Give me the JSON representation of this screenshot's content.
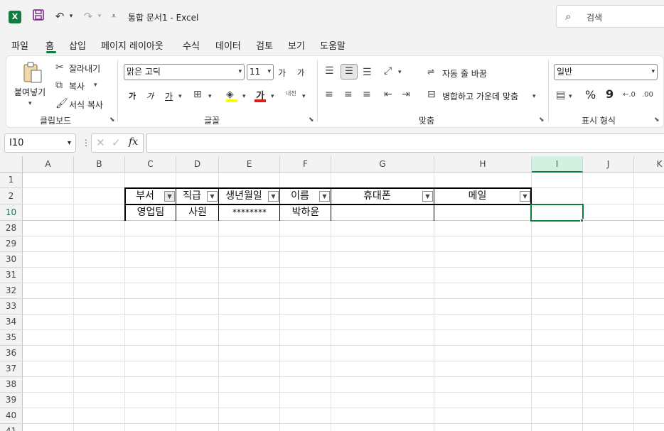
{
  "titlebar": {
    "app_icon": "excel-logo",
    "doc_title": "통합 문서1  -  Excel",
    "search_placeholder": "검색"
  },
  "tabs": [
    "파일",
    "홈",
    "삽입",
    "페이지 레이아웃",
    "수식",
    "데이터",
    "검토",
    "보기",
    "도움말"
  ],
  "ribbon": {
    "clipboard": {
      "paste": "붙여넣기",
      "cut": "잘라내기",
      "copy": "복사",
      "format_painter": "서식 복사",
      "label": "클립보드"
    },
    "font": {
      "font_name": "맑은 고딕",
      "font_size": "11",
      "grow": "가",
      "shrink": "가",
      "bold": "가",
      "italic": "가",
      "underline": "가",
      "font_color_glyph": "가",
      "phonetic": "내천",
      "label": "글꼴"
    },
    "alignment": {
      "wrap_text": "자동 줄 바꿈",
      "merge_center": "병합하고 가운데 맞춤",
      "label": "맞춤"
    },
    "number": {
      "format": "일반",
      "percent": "%",
      "comma": "9",
      "label": "표시 형식"
    },
    "colors": {
      "highlight": "#ffff00",
      "font_color": "#e01b1b",
      "accent": "#107c41"
    }
  },
  "formula_bar": {
    "name_box": "I10",
    "fx": "fx",
    "formula": ""
  },
  "sheet": {
    "columns": [
      "A",
      "B",
      "C",
      "D",
      "E",
      "F",
      "G",
      "H",
      "I",
      "J",
      "K"
    ],
    "rows": [
      "1",
      "2",
      "10",
      "28",
      "29",
      "30",
      "31",
      "32",
      "33",
      "34",
      "35",
      "36",
      "37",
      "38",
      "39",
      "40",
      "41"
    ],
    "selected_cell": "I10",
    "table_headers": [
      "부서",
      "직급",
      "생년월일",
      "이름",
      "휴대폰",
      "메일"
    ],
    "table_row": [
      "영업팀",
      "사원",
      "********",
      "박하윤",
      "",
      ""
    ]
  }
}
